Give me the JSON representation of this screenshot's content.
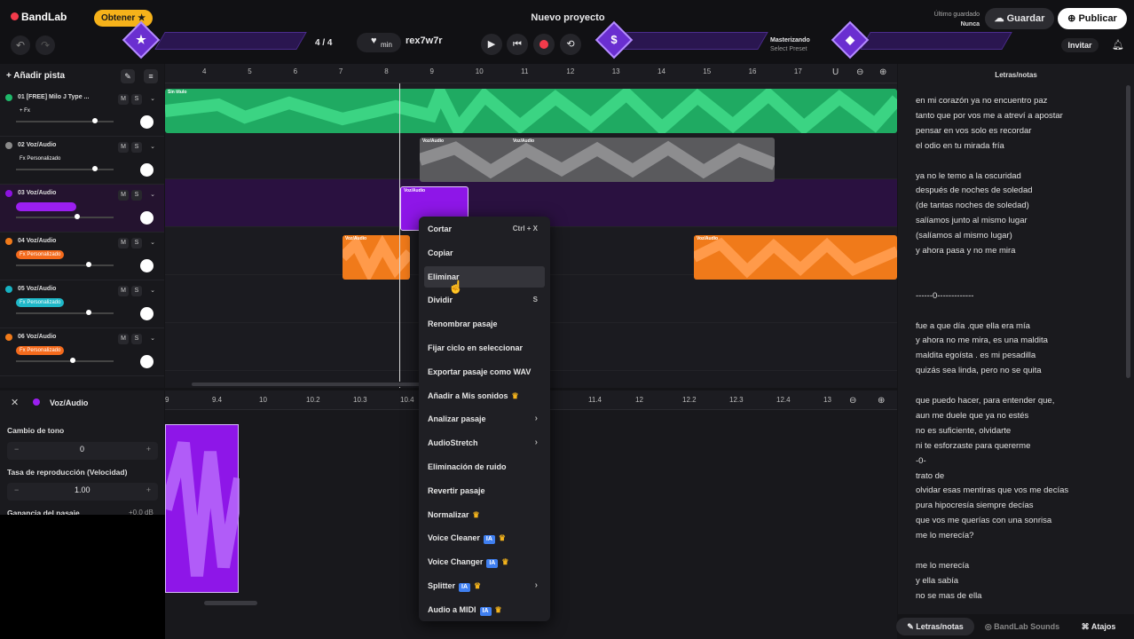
{
  "header": {
    "logo": "BandLab",
    "obtener": "Obtener ★",
    "project_title": "Nuevo proyecto",
    "saved_label": "Último guardado",
    "saved_value": "Nunca",
    "guardar": "Guardar",
    "publicar": "Publicar",
    "invitar": "Invitar"
  },
  "transport": {
    "time_sig": "4 / 4",
    "min_label": "min",
    "key": "rex7w7r",
    "mastering_label": "Masterizando",
    "preset": "Select Preset"
  },
  "tracks": {
    "add_track": "Añadir pista",
    "items": [
      {
        "name": "01 [FREE] Milo J Type ...",
        "fx": "+ Fx",
        "fx_color": "",
        "color": "#1fb86a",
        "mute": "M",
        "solo": "S",
        "level": 0.78
      },
      {
        "name": "02 Voz/Audio",
        "fx": "Fx Personalizado",
        "fx_color": "",
        "color": "#8a8a8a",
        "mute": "M",
        "solo": "S",
        "level": 0.78
      },
      {
        "name": "03 Voz/Audio",
        "fx": "",
        "fx_color": "#9b1ff0",
        "color": "#8c12e0",
        "mute": "M",
        "solo": "S",
        "level": 0.6
      },
      {
        "name": "04 Voz/Audio",
        "fx": "Fx Personalizado",
        "fx_color": "#f46a1c",
        "color": "#f07a1a",
        "mute": "M",
        "solo": "S",
        "level": 0.72
      },
      {
        "name": "05 Voz/Audio",
        "fx": "Fx Personalizado",
        "fx_color": "#1fb8c8",
        "color": "#17b2c2",
        "mute": "M",
        "solo": "S",
        "level": 0.72
      },
      {
        "name": "06 Voz/Audio",
        "fx": "Fx Personalizado",
        "fx_color": "#f46a1c",
        "color": "#f07a1a",
        "mute": "M",
        "solo": "S",
        "level": 0.55
      }
    ]
  },
  "ruler": {
    "numbers": [
      "4",
      "5",
      "6",
      "7",
      "8",
      "9",
      "10",
      "11",
      "12",
      "13",
      "14",
      "15",
      "16",
      "17"
    ]
  },
  "clips": {
    "green_label": "Sin título",
    "voz_label": "Voz/Audio"
  },
  "context_menu": {
    "items": [
      {
        "label": "Cortar",
        "shortcut": "Ctrl + X"
      },
      {
        "label": "Copiar",
        "shortcut": ""
      },
      {
        "label": "Eliminar",
        "shortcut": ""
      },
      {
        "label": "Dividir",
        "shortcut": "S"
      },
      {
        "label": "Renombrar pasaje",
        "shortcut": ""
      },
      {
        "label": "Fijar ciclo en seleccionar",
        "shortcut": ""
      },
      {
        "label": "Exportar pasaje como WAV",
        "shortcut": ""
      },
      {
        "label": "Añadir a Mis sonidos",
        "shortcut": ""
      },
      {
        "label": "Analizar pasaje",
        "shortcut": ""
      },
      {
        "label": "AudioStretch",
        "shortcut": ""
      },
      {
        "label": "Eliminación de ruido",
        "shortcut": ""
      },
      {
        "label": "Revertir pasaje",
        "shortcut": ""
      },
      {
        "label": "Normalizar",
        "shortcut": ""
      },
      {
        "label": "Voice Cleaner",
        "shortcut": ""
      },
      {
        "label": "Voice Changer",
        "shortcut": ""
      },
      {
        "label": "Splitter",
        "shortcut": ""
      },
      {
        "label": "Audio a MIDI",
        "shortcut": ""
      }
    ],
    "ia_badge": "IA"
  },
  "editor": {
    "title": "Voz/Audio",
    "pitch_label": "Cambio de tono",
    "pitch_value": "0",
    "rate_label": "Tasa de reproducción (Velocidad)",
    "rate_value": "1.00",
    "gain_label": "Ganancia del pasaje",
    "gain_value": "+0.0 dB",
    "ruler": [
      "9",
      "9.4",
      "10",
      "10.2",
      "10.3",
      "10.4",
      "11.4",
      "12",
      "12.2",
      "12.3",
      "12.4",
      "13"
    ]
  },
  "lyrics": {
    "title": "Letras/notas",
    "lines": [
      "en mi corazón ya no encuentro paz",
      "tanto que por vos me a  atreví a apostar",
      "pensar en vos solo es recordar",
      "el odio en tu mirada fría",
      "",
      "ya no le temo a la oscuridad",
      "después de noches de soledad",
      "(de tantas noches de soledad)",
      "salíamos junto  al  mismo lugar",
      "(salíamos al mismo lugar)",
      "y ahora pasa y no me mira",
      "",
      "",
      "------0-------------",
      "",
      "fue a que día .que ella era mía",
      "y ahora no me mira, es una maldita",
      "maldita egoísta . es mi pesadilla",
      "quizás sea linda, pero no se quita",
      "",
      "que puedo hacer, para entender que,",
      "aun me duele que ya no estés",
      "no es suficiente, olvidarte",
      "ni te esforzaste para quererme",
      "-0-",
      "trato de",
      "olvidar esas mentiras que vos me decías",
      "pura hipocresía siempre decías",
      "que vos me querías con una sonrisa",
      "me lo merecía?",
      "",
      "me lo merecía",
      "y ella sabía",
      "no se mas de ella"
    ]
  },
  "bottom_tabs": {
    "letras": "Letras/notas",
    "sounds": "BandLab Sounds",
    "atajos": "Atajos"
  }
}
